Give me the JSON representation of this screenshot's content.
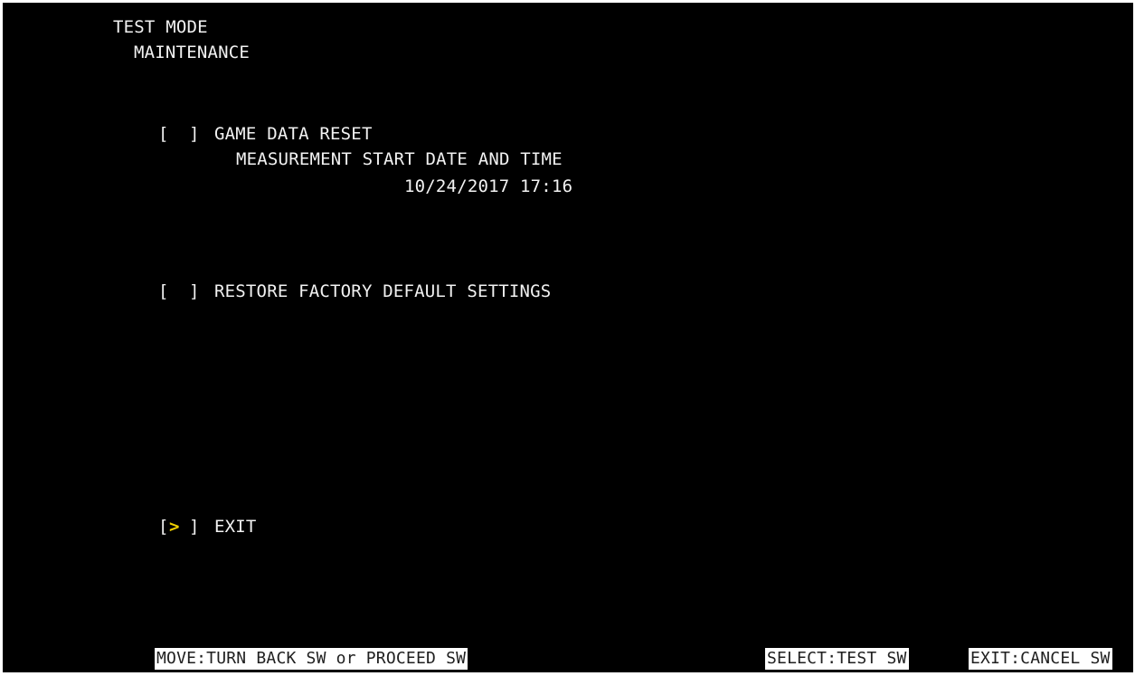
{
  "header": {
    "title": "TEST MODE",
    "subtitle": "MAINTENANCE"
  },
  "menu": {
    "reset": {
      "bracket_left": "[",
      "bracket_right": "]",
      "label": "GAME DATA RESET",
      "detail_label": "MEASUREMENT START DATE AND TIME",
      "detail_value": "10/24/2017 17:16"
    },
    "restore": {
      "bracket_left": "[",
      "bracket_right": "]",
      "label": "RESTORE FACTORY DEFAULT SETTINGS"
    },
    "exit": {
      "bracket_left": "[",
      "bracket_right": "]",
      "cursor": ">",
      "label": "EXIT",
      "selected": true
    }
  },
  "footer": {
    "move": "MOVE:TURN BACK SW or PROCEED SW",
    "select": "SELECT:TEST SW",
    "exit": "EXIT:CANCEL SW"
  },
  "colors": {
    "background": "#000000",
    "text": "#f2f2f2",
    "cursor": "#f0d000",
    "footer_bg": "#ffffff",
    "footer_text": "#202020"
  }
}
